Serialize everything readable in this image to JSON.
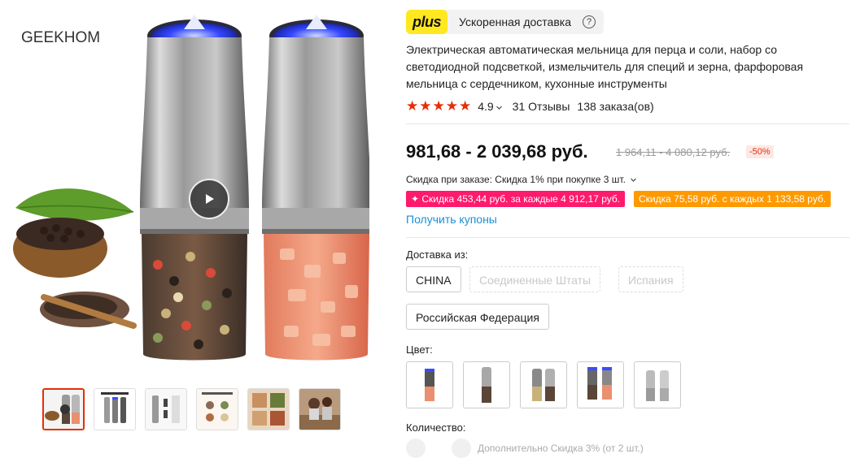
{
  "gallery": {
    "brand_logo": "GEEKHOM",
    "thumbnail_count": 6,
    "active_thumbnail": 1
  },
  "delivery_plus": {
    "badge": "plus",
    "label": "Ускоренная доставка",
    "help_glyph": "?"
  },
  "product": {
    "title": "Электрическая автоматическая мельница для перца и соли, набор со светодиодной подсветкой, измельчитель для специй и зерна, фарфоровая мельница с сердечником, кухонные инструменты",
    "stars": "★★★★★",
    "rating": "4.9",
    "reviews": "31 Отзывы",
    "orders": "138 заказа(ов)"
  },
  "pricing": {
    "price_range": "981,68 - 2 039,68 руб.",
    "old_price_range": "1 964,11 - 4 080,12 руб.",
    "discount": "-50%",
    "promo": "Скидка при заказе: Скидка 1% при покупке 3 шт.",
    "coupon_primary": "✦ Скидка 453,44 руб. за каждые 4 912,17 руб.",
    "coupon_secondary": "Скидка 75,58 руб. с каждых 1 133,58 руб.",
    "get_coupons_link": "Получить купоны"
  },
  "ship_from": {
    "label": "Доставка из:",
    "options": [
      "CHINA",
      "Соединенные Штаты",
      "Испания",
      "Российская Федерация"
    ],
    "disabled": [
      false,
      true,
      true,
      false
    ],
    "selected": "CHINA"
  },
  "color": {
    "label": "Цвет:",
    "option_count": 5
  },
  "quantity": {
    "label": "Количество:",
    "extra_discount": "Дополнительно Скидка 3% (от 2 шт.)"
  },
  "colors": {
    "accent": "#e62e04",
    "link": "#1a8fd6",
    "coupon_pink": "#ff1a6c",
    "coupon_orange": "#ff9900",
    "plus_yellow": "#ffe81f"
  },
  "icons": [
    "play-icon",
    "help-icon",
    "chevron-down-icon",
    "star-icon"
  ]
}
